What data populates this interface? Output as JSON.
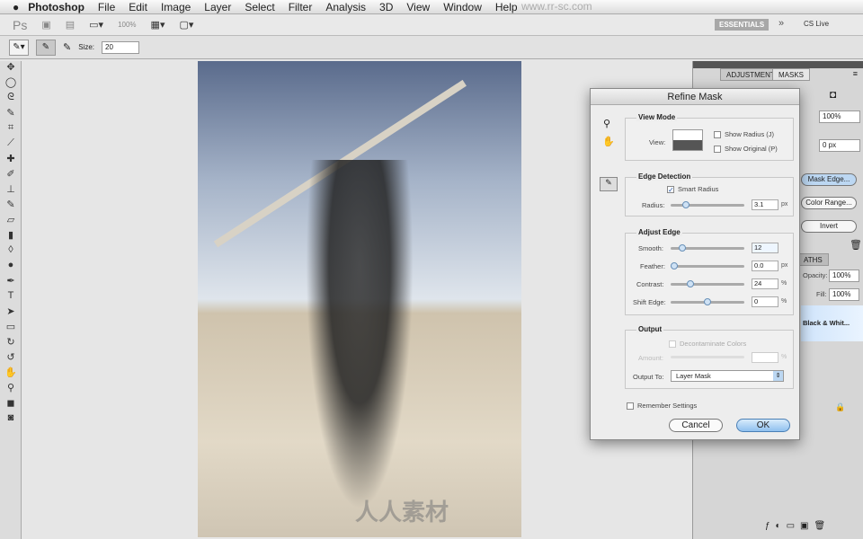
{
  "menubar": {
    "apple": "",
    "app": "Photoshop",
    "items": [
      "File",
      "Edit",
      "Image",
      "Layer",
      "Select",
      "Filter",
      "Analysis",
      "3D",
      "View",
      "Window",
      "Help"
    ]
  },
  "appbar": {
    "logo": "Ps",
    "zoom": "100%",
    "workspace": "ESSENTIALS",
    "cs_live": "CS Live"
  },
  "options": {
    "size_label": "Size:",
    "size_value": "20"
  },
  "panel": {
    "tabs": [
      "ADJUSTMENTS",
      "MASKS"
    ],
    "density": "100%",
    "feather": "0 px",
    "mask_edge": "Mask Edge...",
    "color_range": "Color Range...",
    "invert": "Invert",
    "layers_tab": "ATHS",
    "opacity_label": "Opacity:",
    "opacity": "100%",
    "fill_label": "Fill:",
    "fill": "100%",
    "layer_name": "Black & Whit..."
  },
  "dialog": {
    "title": "Refine Mask",
    "view_mode": {
      "label": "View Mode",
      "view": "View:",
      "show_radius": "Show Radius (J)",
      "show_original": "Show Original (P)"
    },
    "edge_detection": {
      "label": "Edge Detection",
      "smart_radius": "Smart Radius",
      "smart_radius_checked": true,
      "radius_label": "Radius:",
      "radius": "3.1",
      "radius_unit": "px",
      "radius_pos": 0.18
    },
    "adjust_edge": {
      "label": "Adjust Edge",
      "smooth_label": "Smooth:",
      "smooth": "12",
      "smooth_pos": 0.12,
      "feather_label": "Feather:",
      "feather": "0.0",
      "feather_unit": "px",
      "feather_pos": 0,
      "contrast_label": "Contrast:",
      "contrast": "24",
      "contrast_unit": "%",
      "contrast_pos": 0.24,
      "shift_label": "Shift Edge:",
      "shift": "0",
      "shift_unit": "%",
      "shift_pos": 0.5
    },
    "output": {
      "label": "Output",
      "decontaminate": "Decontaminate Colors",
      "amount": "Amount:",
      "amount_unit": "%",
      "output_to_label": "Output To:",
      "output_to": "Layer Mask"
    },
    "remember": "Remember Settings",
    "cancel": "Cancel",
    "ok": "OK"
  },
  "watermark": {
    "site": "www.rr-sc.com",
    "cn": "人人素材"
  }
}
